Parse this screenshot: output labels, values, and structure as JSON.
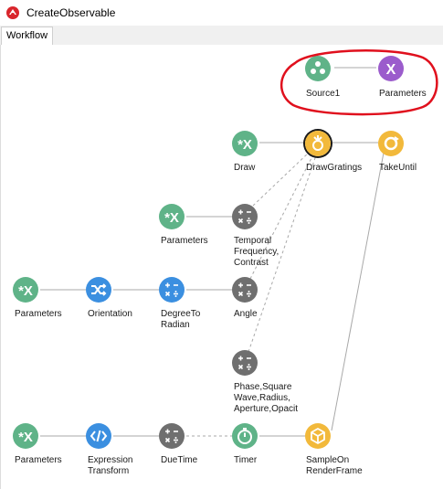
{
  "window": {
    "title": "CreateObservable"
  },
  "tabs": [
    {
      "label": "Workflow"
    }
  ],
  "colors": {
    "green": "#5fb388",
    "blue": "#3b8fe0",
    "gray": "#6f6f6f",
    "yellow": "#f2b93b",
    "purple": "#9b5ccc",
    "annotation": "#e0101d"
  },
  "nodes": {
    "source1": {
      "label": "Source1",
      "icon": "source-icon"
    },
    "parameters_top": {
      "label": "Parameters",
      "icon": "property-mapping-icon"
    },
    "draw": {
      "label": "Draw",
      "icon": "property-mapping-icon"
    },
    "draw_gratings": {
      "label": "DrawGratings",
      "icon": "draw-gratings-icon"
    },
    "take_until": {
      "label": "TakeUntil",
      "icon": "take-until-icon"
    },
    "parameters_temporal": {
      "label": "Parameters",
      "icon": "property-mapping-icon"
    },
    "temporal": {
      "label": "Temporal\nFrequency,\nContrast",
      "icon": "expression-icon"
    },
    "parameters_orientation": {
      "label": "Parameters",
      "icon": "property-mapping-icon"
    },
    "orientation": {
      "label": "Orientation",
      "icon": "shuffle-icon"
    },
    "degree_to_radian": {
      "label": "DegreeTo\nRadian",
      "icon": "math-icon"
    },
    "angle": {
      "label": "Angle",
      "icon": "expression-icon"
    },
    "phase": {
      "label": "Phase,Square\nWave,Radius,\nAperture,Opacit",
      "icon": "expression-icon"
    },
    "parameters_bottom": {
      "label": "Parameters",
      "icon": "property-mapping-icon"
    },
    "expression_transform": {
      "label": "Expression\nTransform",
      "icon": "code-icon"
    },
    "due_time": {
      "label": "DueTime",
      "icon": "expression-icon"
    },
    "timer": {
      "label": "Timer",
      "icon": "timer-icon"
    },
    "sample_on_render_frame": {
      "label": "SampleOn\nRenderFrame",
      "icon": "cube-icon"
    }
  }
}
